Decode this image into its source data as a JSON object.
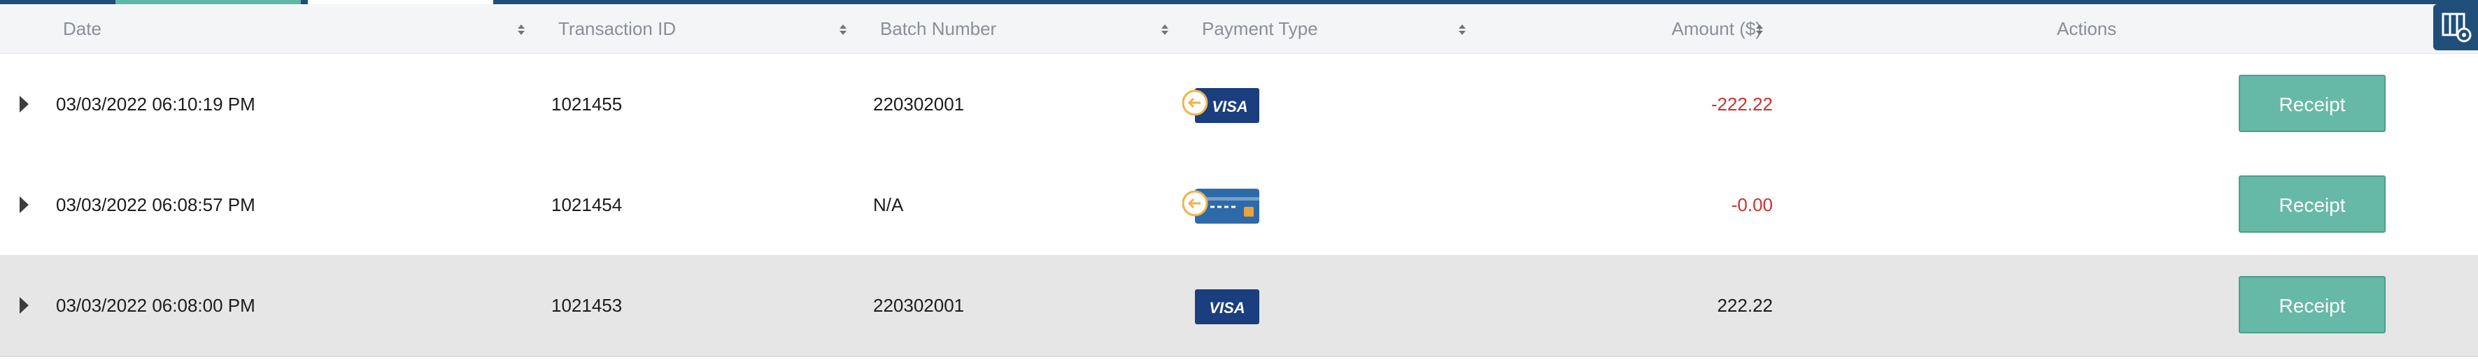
{
  "colors": {
    "header_bg": "#f4f5f7",
    "accent_bar": "#1f4e79",
    "receipt_button": "#66b9a7",
    "negative_amount": "#d0312d",
    "positive_amount": "#1c1c1c",
    "highlight_row": "#e6e6e6"
  },
  "table": {
    "columns": {
      "date": "Date",
      "transaction_id": "Transaction ID",
      "batch_number": "Batch Number",
      "payment_type": "Payment Type",
      "amount": "Amount ($)",
      "actions": "Actions"
    },
    "rows": [
      {
        "date": "03/03/2022 06:10:19 PM",
        "transaction_id": "1021455",
        "batch_number": "220302001",
        "payment_type_icon": "visa-refund-icon",
        "amount": "-222.22",
        "action": "Receipt"
      },
      {
        "date": "03/03/2022 06:08:57 PM",
        "transaction_id": "1021454",
        "batch_number": "N/A",
        "payment_type_icon": "card-refund-icon",
        "amount": "-0.00",
        "action": "Receipt"
      },
      {
        "date": "03/03/2022 06:08:00 PM",
        "transaction_id": "1021453",
        "batch_number": "220302001",
        "payment_type_icon": "visa-icon",
        "amount": "222.22",
        "action": "Receipt"
      }
    ]
  },
  "toolbar": {
    "icon": "column-settings-icon"
  }
}
